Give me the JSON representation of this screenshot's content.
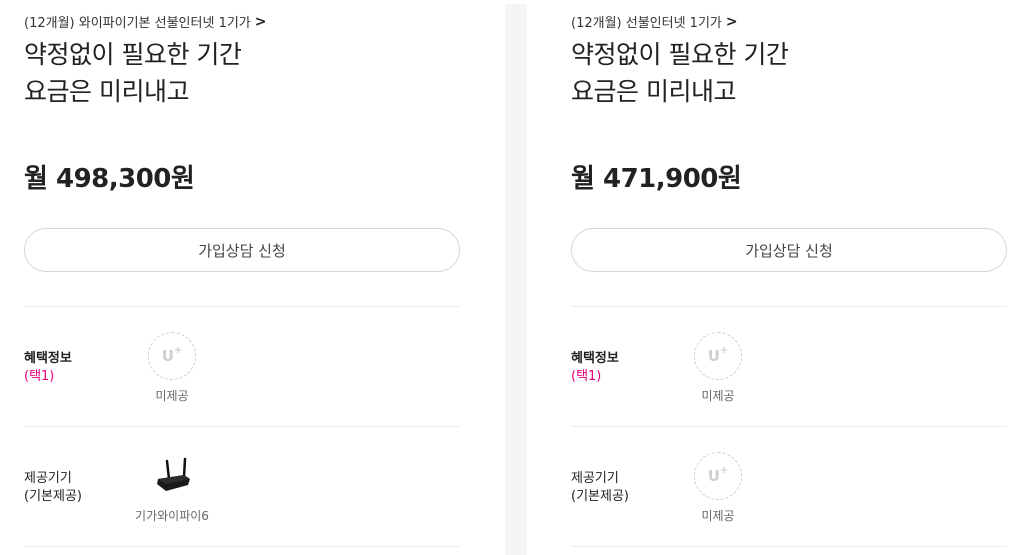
{
  "left": {
    "plan_link": "(12개월) 와이파이기본 선불인터넷 1기가",
    "headline_line1": "약정없이 필요한 기간",
    "headline_line2": "요금은 미리내고",
    "price": "월 498,300원",
    "consult_button": "가입상담 신청",
    "benefit": {
      "label": "혜택정보",
      "sub": "(택1)",
      "caption": "미제공",
      "icon": "uplus-placeholder-icon"
    },
    "device": {
      "label_line1": "제공기기",
      "label_line2": "(기본제공)",
      "caption": "기가와이파이6",
      "icon": "router-icon"
    }
  },
  "right": {
    "plan_link": "(12개월) 선불인터넷 1기가",
    "headline_line1": "약정없이 필요한 기간",
    "headline_line2": "요금은 미리내고",
    "price": "월 471,900원",
    "consult_button": "가입상담 신청",
    "benefit": {
      "label": "혜택정보",
      "sub": "(택1)",
      "caption": "미제공",
      "icon": "uplus-placeholder-icon"
    },
    "device": {
      "label_line1": "제공기기",
      "label_line2": "(기본제공)",
      "caption": "미제공",
      "icon": "uplus-placeholder-icon"
    }
  },
  "common": {
    "chevron": ">",
    "uplus_text": "U",
    "uplus_sup": "+"
  },
  "colors": {
    "accent_pink": "#e6007e",
    "divider": "#f5f5f7"
  }
}
